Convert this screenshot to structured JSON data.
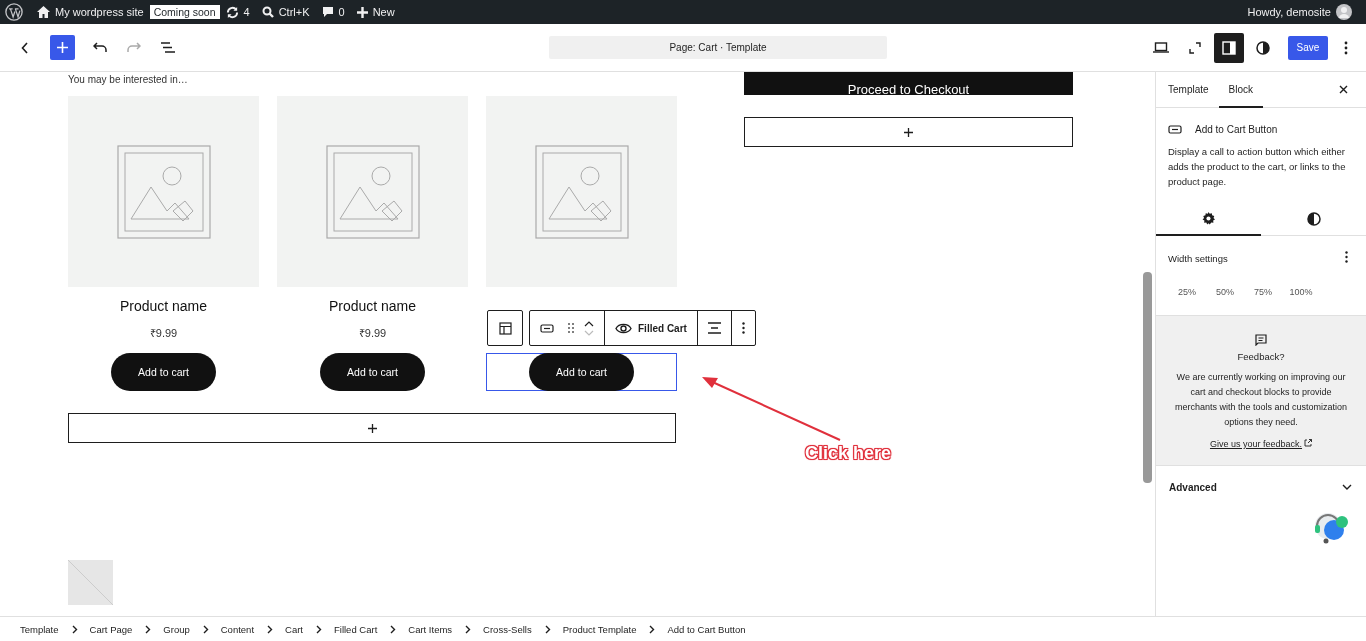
{
  "admin_bar": {
    "site_name": "My wordpress site",
    "badge": "Coming soon",
    "updates": "4",
    "search_shortcut": "Ctrl+K",
    "comments": "0",
    "new_label": "New",
    "greeting": "Howdy, demosite"
  },
  "header": {
    "document_title": "Page: Cart · Template",
    "save_label": "Save",
    "settings_panel_open": true
  },
  "canvas": {
    "heading": "You may be interested in…",
    "products": [
      {
        "name": "Product name",
        "price": "₹9.99",
        "button": "Add to cart",
        "selected": false
      },
      {
        "name": "Product name",
        "price": "₹9.99",
        "button": "Add to cart",
        "selected": false
      },
      {
        "button": "Add to cart",
        "selected": true
      }
    ],
    "checkout_button": "Proceed to Checkout",
    "block_toolbar": {
      "parent_label": "Filled Cart"
    },
    "annotation": "Click here"
  },
  "sidebar": {
    "tabs": [
      {
        "label": "Template",
        "selected": false
      },
      {
        "label": "Block",
        "selected": true
      }
    ],
    "block_title": "Add to Cart Button",
    "block_description": "Display a call to action button which either adds the product to the cart, or links to the product page.",
    "style_tabs": [
      {
        "kind": "settings",
        "selected": true
      },
      {
        "kind": "styles",
        "selected": false
      }
    ],
    "width_panel": {
      "title": "Width settings",
      "options": [
        {
          "label": "25%",
          "selected": false
        },
        {
          "label": "50%",
          "selected": false
        },
        {
          "label": "75%",
          "selected": false
        },
        {
          "label": "100%",
          "selected": false
        }
      ]
    },
    "feedback": {
      "title": "Feedback?",
      "text": "We are currently working on improving our cart and checkout blocks to provide merchants with the tools and customization options they need.",
      "link": "Give us your feedback."
    },
    "advanced": {
      "title": "Advanced",
      "expanded": false
    }
  },
  "breadcrumbs": [
    "Template",
    "Cart Page",
    "Group",
    "Content",
    "Cart",
    "Filled Cart",
    "Cart Items",
    "Cross-Sells",
    "Product Template",
    "Add to Cart Button"
  ]
}
